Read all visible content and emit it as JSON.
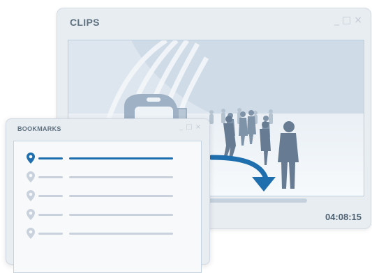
{
  "clips": {
    "title": "CLIPS",
    "timecode": "04:08:15",
    "progress_fraction": 0.28
  },
  "bookmarks": {
    "title": "BOOKMARKS",
    "items": [
      {
        "active": true
      },
      {
        "active": false
      },
      {
        "active": false
      },
      {
        "active": false
      },
      {
        "active": false
      }
    ]
  },
  "icons": {
    "window_controls": [
      "minimize-icon",
      "maximize-icon",
      "close-icon"
    ],
    "bookmark_pin": "map-pin-icon",
    "seek_arrow": "curved-arrow-down-icon"
  },
  "colors": {
    "accent": "#1f6fae",
    "inactive": "#c9d2dc",
    "window_bg": "#e8edf2"
  }
}
